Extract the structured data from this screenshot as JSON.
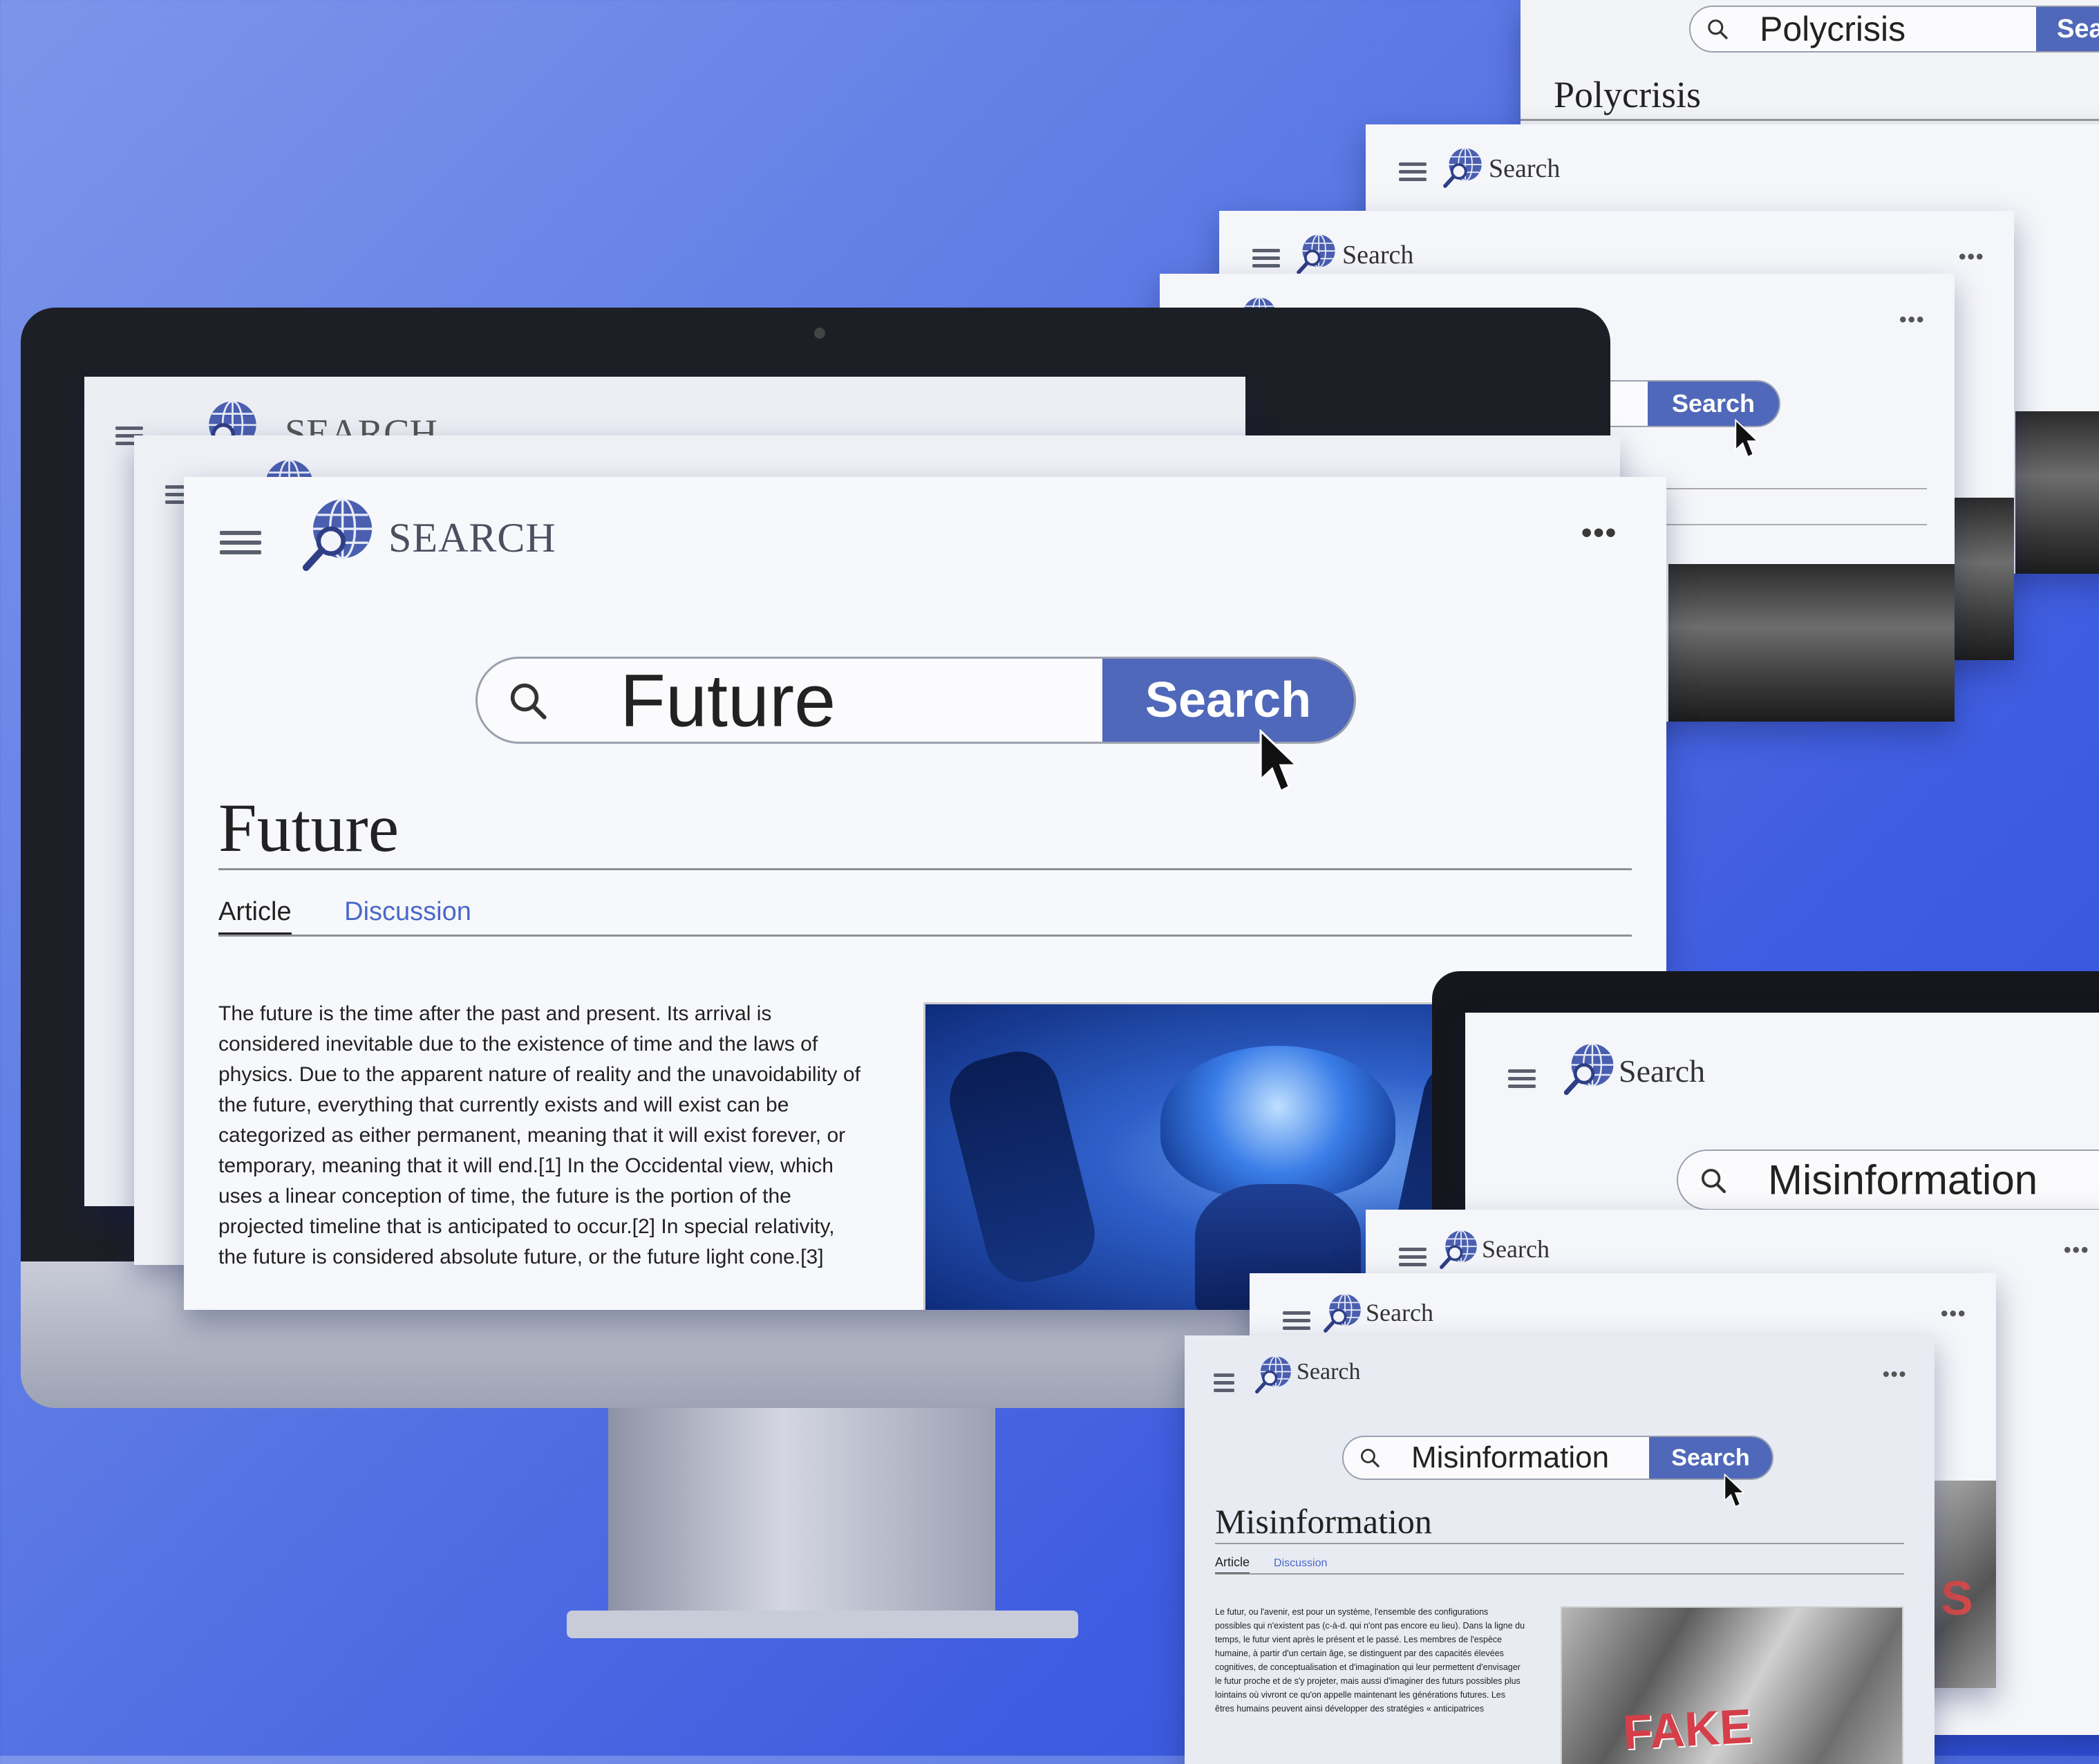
{
  "brand": {
    "name": "Search",
    "name_smallcaps": "SEARCH"
  },
  "menu_dots": "•••",
  "main": {
    "query": "Future",
    "button": "Search",
    "title": "Future",
    "tab_article": "Article",
    "tab_discussion": "Discussion",
    "body": "The future is the time after the past and present. Its arrival is considered inevitable due to the existence of time and the laws of physics. Due to the apparent nature of reality and the unavoidability of the future, everything that currently exists and will exist can be categorized as either permanent, meaning that it will exist forever, or temporary, meaning that it will end.[1] In the Occidental view, which uses a linear conception of time, the future is the portion of the projected timeline that is anticipated to occur.[2] In special relativity, the future is considered absolute future, or the future light cone.[3]"
  },
  "polycrisis": {
    "query": "Polycrisis",
    "button": "Search",
    "button_partial": "Searc",
    "title": "Polycrisis"
  },
  "misinformation": {
    "query": "Misinformation",
    "button": "Search",
    "title": "Misinformation",
    "tab_article": "Article",
    "tab_discussion": "Discussion",
    "body": "Le futur, ou l'avenir, est pour un système, l'ensemble des configurations possibles qui n'existent pas (c-à-d. qui n'ont pas encore eu lieu). Dans la ligne du temps, le futur vient après le présent et le passé. Les membres de l'espèce humaine, à partir d'un certain âge, se distinguent par des capacités élevées cognitives, de conceptualisation et d'imagination qui leur permettent d'envisager le futur proche et de s'y projeter, mais aussi d'imaginer des futurs possibles plus lointains où vivront ce qu'on appelle maintenant les générations futures. Les êtres humains peuvent ainsi développer des stratégies « anticipatrices",
    "image_text": "FAKE NEWS",
    "image_text_partial": "S"
  },
  "icons": [
    "hamburger-icon",
    "globe-search-icon",
    "search-icon",
    "cursor-icon",
    "more-dots-icon"
  ],
  "colors": {
    "accent": "#5068b9",
    "link": "#4a68c9",
    "background": "#4f6ee2"
  }
}
